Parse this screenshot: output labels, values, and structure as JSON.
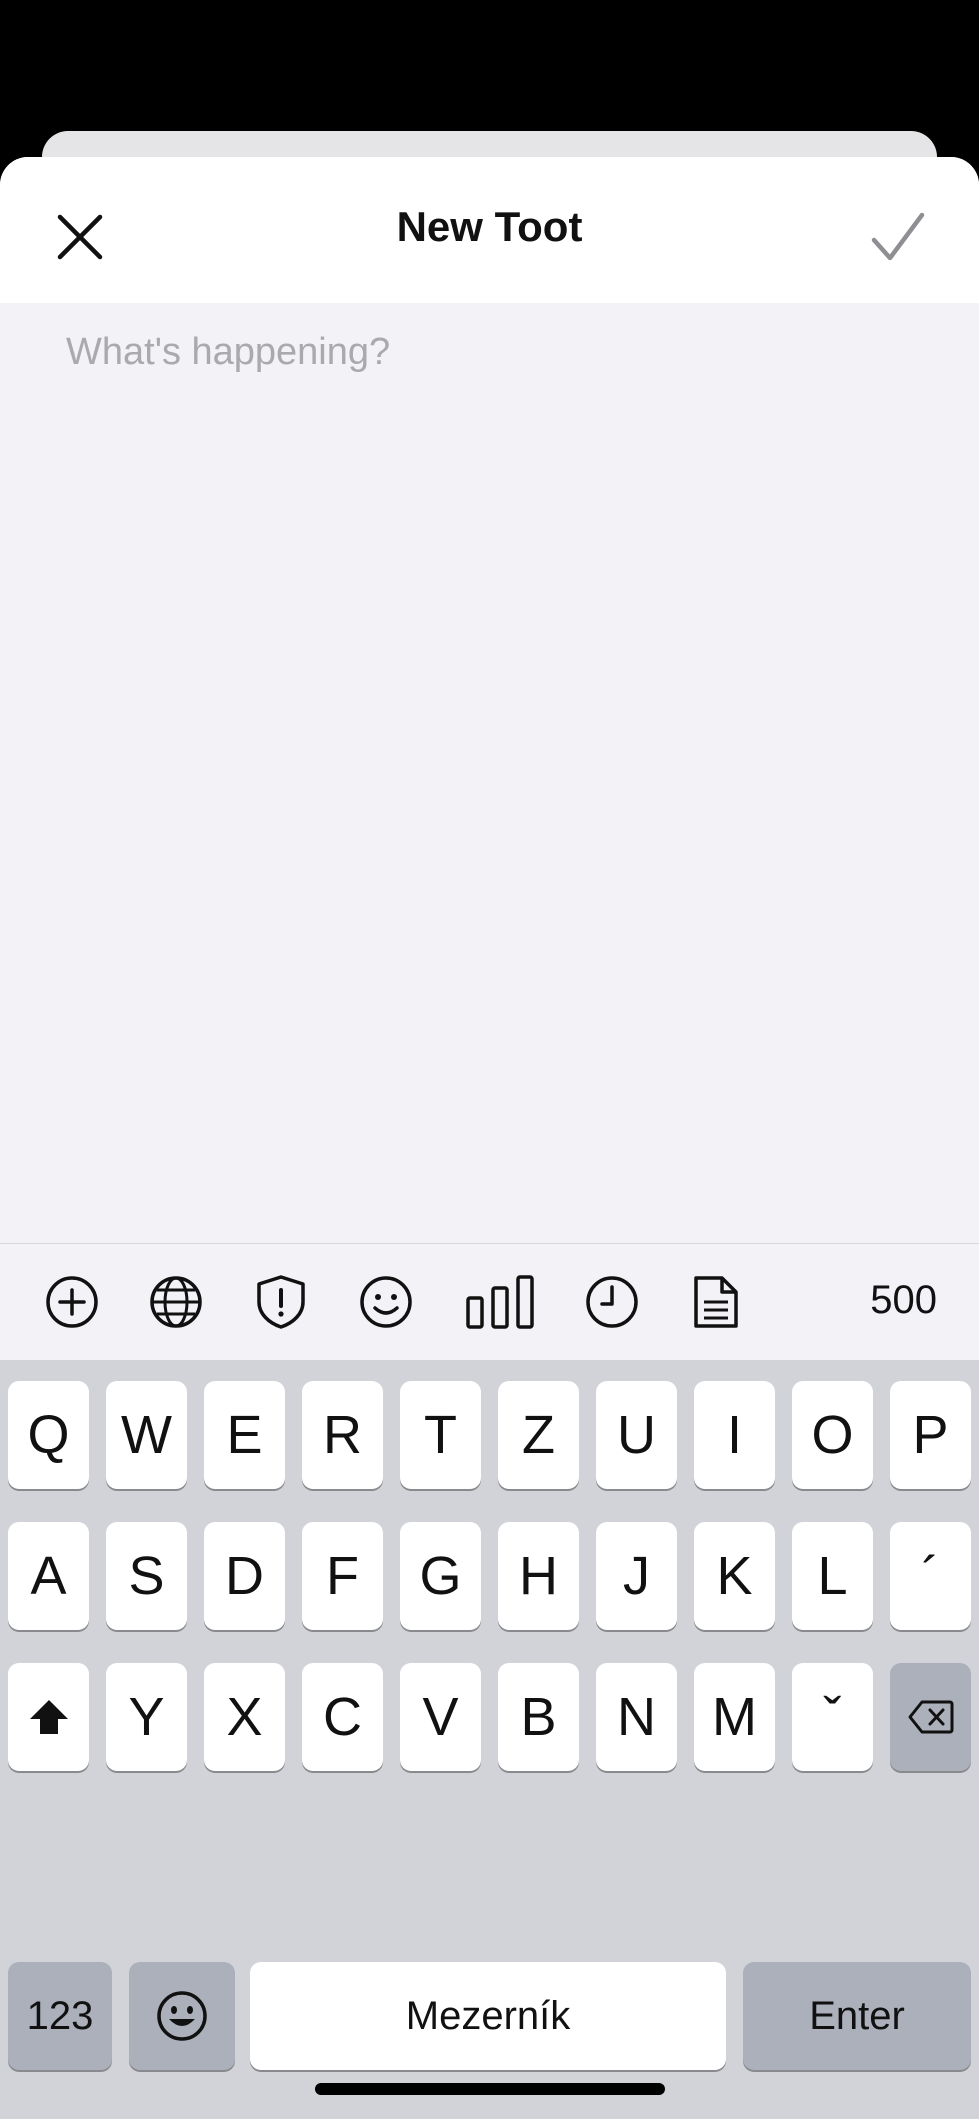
{
  "header": {
    "title": "New Toot",
    "close_icon": "close-icon",
    "done_icon": "checkmark-icon"
  },
  "compose": {
    "placeholder": "What's happening?",
    "value": ""
  },
  "toolbar": {
    "icons": [
      "add-attachment-icon",
      "globe-visibility-icon",
      "content-warning-icon",
      "emoji-icon",
      "poll-icon",
      "schedule-icon",
      "drafts-icon"
    ],
    "char_count": "500"
  },
  "keyboard": {
    "row1": [
      "Q",
      "W",
      "E",
      "R",
      "T",
      "Z",
      "U",
      "I",
      "O",
      "P"
    ],
    "row2": [
      "A",
      "S",
      "D",
      "F",
      "G",
      "H",
      "J",
      "K",
      "L",
      "´"
    ],
    "row3": [
      "Y",
      "X",
      "C",
      "V",
      "B",
      "N",
      "M",
      "ˇ"
    ],
    "numbers_label": "123",
    "space_label": "Mezerník",
    "enter_label": "Enter"
  },
  "colors": {
    "background": "#f2f2f7",
    "keyboard_bg": "#d1d3d9",
    "placeholder": "#a9a9ae"
  }
}
